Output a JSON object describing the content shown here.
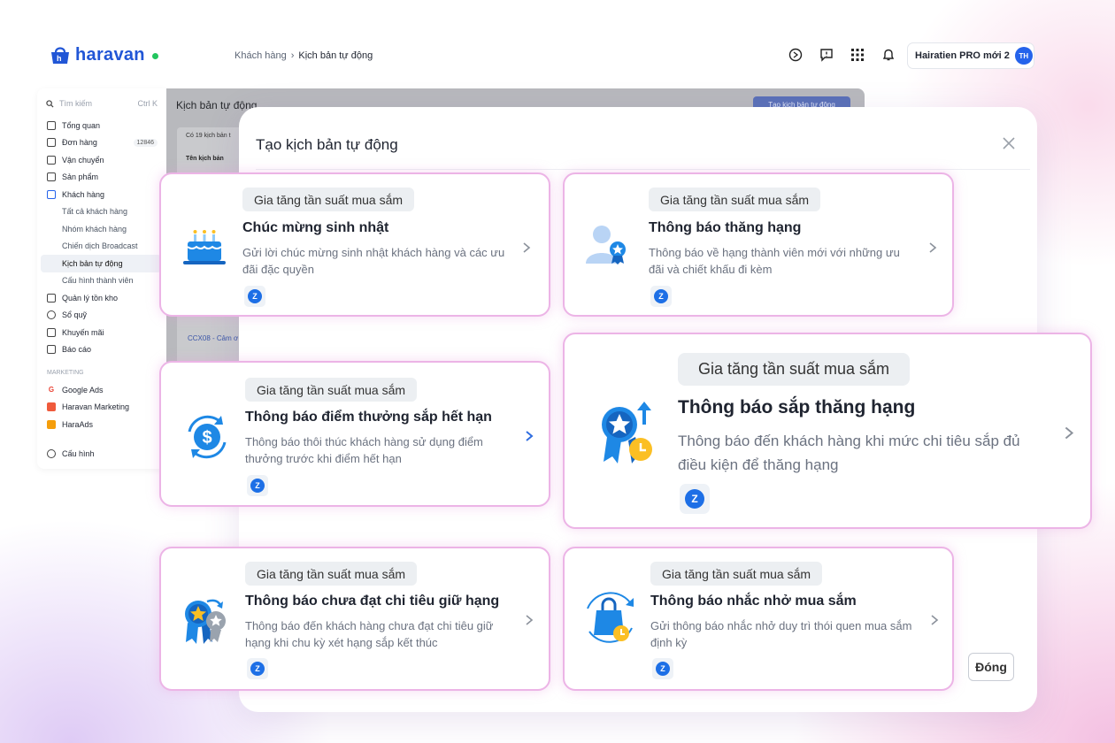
{
  "header": {
    "logo_text": "haravan",
    "breadcrumb": [
      "Khách hàng",
      "Kịch bản tự động"
    ],
    "breadcrumb_sep": "›",
    "account_name": "Hairatien PRO mới 2",
    "avatar_initials": "TH"
  },
  "sidebar": {
    "search_placeholder": "Tìm kiếm",
    "search_shortcut": "Ctrl K",
    "items": [
      {
        "label": "Tổng quan"
      },
      {
        "label": "Đơn hàng",
        "badge": "12846"
      },
      {
        "label": "Vận chuyển"
      },
      {
        "label": "Sản phẩm"
      },
      {
        "label": "Khách hàng"
      }
    ],
    "sub_items": [
      {
        "label": "Tất cả khách hàng"
      },
      {
        "label": "Nhóm khách hàng"
      },
      {
        "label": "Chiến dịch Broadcast"
      },
      {
        "label": "Kịch bản tự động"
      },
      {
        "label": "Cấu hình thành viên"
      }
    ],
    "items2": [
      {
        "label": "Quản lý tồn kho"
      },
      {
        "label": "Sổ quỹ"
      },
      {
        "label": "Khuyến mãi"
      },
      {
        "label": "Báo cáo"
      }
    ],
    "marketing_heading": "MARKETING",
    "marketing_items": [
      {
        "label": "Google Ads"
      },
      {
        "label": "Haravan Marketing"
      },
      {
        "label": "HaraAds"
      }
    ],
    "settings_label": "Cấu hình"
  },
  "background_page": {
    "title": "Kịch bản tự động",
    "create_button": "Tạo kịch bản tự động",
    "count_text": "Có 19 kịch bản t",
    "column_header": "Tên kịch bản",
    "row_text": "CCX08 - Cảm ơ"
  },
  "modal": {
    "title": "Tạo kịch bản tự động",
    "close_button": "Đóng",
    "cards": [
      {
        "tag": "Gia tăng tần suất mua sắm",
        "title": "Chúc mừng sinh nhật",
        "desc": "Gửi lời chúc mừng sinh nhật khách hàng và các ưu đãi đặc quyền",
        "icon": "birthday-cake-icon"
      },
      {
        "tag": "Gia tăng tần suất mua sắm",
        "title": "Thông báo thăng hạng",
        "desc": "Thông báo về hạng thành viên mới với những ưu đãi và chiết khấu đi kèm",
        "icon": "member-star-icon"
      },
      {
        "tag": "Gia tăng tần suất mua sắm",
        "title": "Thông báo điểm thưởng sắp hết hạn",
        "desc": "Thông báo thôi thúc khách hàng sử dụng điểm thưởng trước khi điểm hết hạn",
        "icon": "dollar-refresh-icon"
      },
      {
        "tag": "Gia tăng tần suất mua sắm",
        "title": "Thông báo sắp thăng hạng",
        "desc": "Thông báo đến khách hàng khi mức chi tiêu sắp đủ điều kiện để thăng hạng",
        "icon": "medal-upgrade-icon"
      },
      {
        "tag": "Gia tăng tần suất mua sắm",
        "title": "Thông báo chưa đạt chi tiêu giữ hạng",
        "desc": "Thông báo đến khách hàng chưa đạt chi tiêu giữ hạng khi chu kỳ xét hạng sắp kết thúc",
        "icon": "medal-downgrade-icon"
      },
      {
        "tag": "Gia tăng tần suất mua sắm",
        "title": "Thông báo nhắc nhở mua sắm",
        "desc": "Gửi thông báo nhắc nhở duy trì thói quen mua sắm định kỳ",
        "icon": "shopping-bag-clock-icon"
      }
    ],
    "zalo_glyph": "Z"
  },
  "colors": {
    "brand_blue": "#2156d6",
    "card_border": "#ecb4e6",
    "zalo_blue": "#1d6fe6",
    "tag_bg": "#eceff2"
  }
}
